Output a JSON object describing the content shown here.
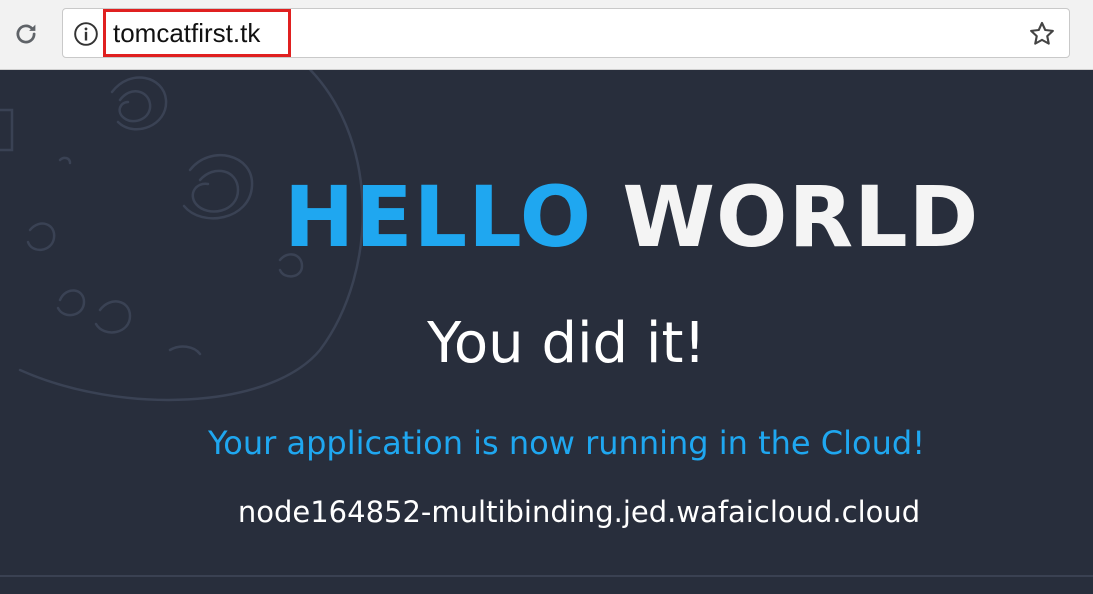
{
  "browser": {
    "url": "tomcatfirst.tk",
    "reload_icon": "reload-icon",
    "info_icon": "info-icon",
    "bookmark_icon": "star-icon",
    "highlight_color": "#e02020"
  },
  "page": {
    "hello": "HELLO",
    "world": "WORLD",
    "headline": "You did it!",
    "subheadline": "Your application is now running in the Cloud!",
    "hostname": "node164852-multibinding.jed.wafaicloud.cloud",
    "colors": {
      "background": "#282e3c",
      "accent": "#1fa7f0",
      "text": "#ffffff"
    }
  }
}
